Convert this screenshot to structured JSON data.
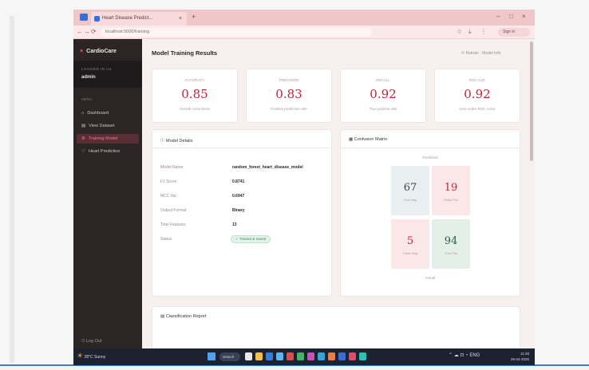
{
  "browser": {
    "tab_title": "Heart Disease Predict...",
    "tab_close": "×",
    "new_tab": "+",
    "url": "localhost:5000/training",
    "back": "←",
    "forward": "→",
    "reload": "⟳",
    "win_min": "–",
    "win_max": "□",
    "win_close": "×",
    "star": "☆",
    "download": "⤓",
    "menu": "⋮",
    "profile": "Sign in"
  },
  "sidebar": {
    "brand": "CardioCare",
    "user_label": "LOGGED IN AS",
    "user_name": "admin",
    "section": "MENU",
    "items": [
      {
        "icon": "⌂",
        "label": "Dashboard"
      },
      {
        "icon": "▤",
        "label": "View Dataset"
      },
      {
        "icon": "⚙",
        "label": "Training Model"
      },
      {
        "icon": "♡",
        "label": "Heart Prediction"
      }
    ],
    "logout": "⎋ Log Out"
  },
  "main": {
    "title": "Model Training Results",
    "top_links": "⟳ Retrain  ·  Model Info",
    "metrics": [
      {
        "label": "ACCURACY",
        "value": "0.85",
        "sub": "Overall correctness"
      },
      {
        "label": "PRECISION",
        "value": "0.83",
        "sub": "Positive prediction rate"
      },
      {
        "label": "RECALL",
        "value": "0.92",
        "sub": "True positive rate"
      },
      {
        "label": "ROC AUC",
        "value": "0.92",
        "sub": "Area under ROC curve"
      }
    ],
    "details": {
      "title": "ⓘ Model Details",
      "rows": [
        {
          "key": "Model Name",
          "value": "random_forest_heart_disease_model"
        },
        {
          "key": "F1 Score",
          "value": "0.8741"
        },
        {
          "key": "MCC Val",
          "value": "0.6947"
        },
        {
          "key": "Output Format",
          "value": "Binary"
        },
        {
          "key": "Total Features",
          "value": "13"
        },
        {
          "key": "Status",
          "badge": "✓ Trained & Saved"
        }
      ]
    },
    "confusion": {
      "title": "▦ Confusion Matrix",
      "caption": "Predicted",
      "cells": [
        {
          "value": "67",
          "sub": "True Neg"
        },
        {
          "value": "19",
          "sub": "False Pos"
        },
        {
          "value": "5",
          "sub": "False Neg"
        },
        {
          "value": "94",
          "sub": "True Pos"
        }
      ],
      "footer": "Actual"
    },
    "report_title": "▤ Classification Report"
  },
  "taskbar": {
    "weather_temp": "28°C",
    "weather_desc": "Sunny",
    "search": "Search",
    "tray": "⌃ ☁ ⊡ ◔ ENG",
    "time": "11:28",
    "date": "26-04-2025"
  },
  "colors": {
    "accent": "#c0253c",
    "sidebar_bg": "#2b2526",
    "tab_bg": "#f0c7c9",
    "cell_true_neg": "#e9eef1",
    "cell_false_pos": "#fbe6e8",
    "cell_false_neg": "#fbe6e8",
    "cell_true_pos": "#e4efe8"
  }
}
